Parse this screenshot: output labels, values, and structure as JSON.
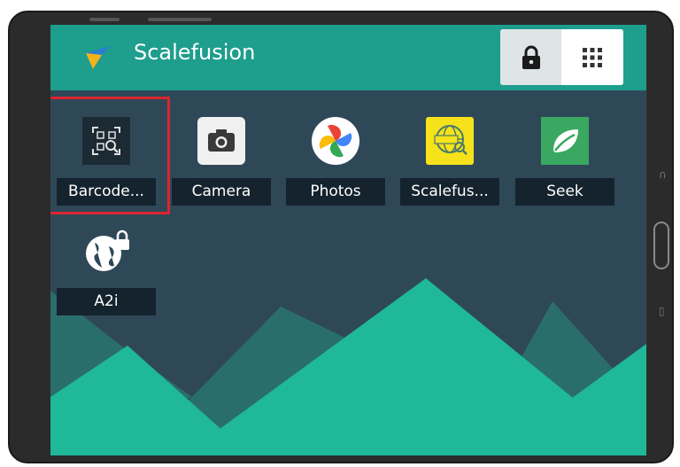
{
  "header": {
    "title": "Scalefusion",
    "logo_icon": "scalefusion-logo-icon",
    "lock_icon": "lock-icon",
    "grid_icon": "app-grid-icon"
  },
  "apps": [
    {
      "label": "Barcode...",
      "icon": "barcode-scanner-icon",
      "highlighted": true
    },
    {
      "label": "Camera",
      "icon": "camera-icon"
    },
    {
      "label": "Photos",
      "icon": "photos-pinwheel-icon"
    },
    {
      "label": "Scalefus...",
      "icon": "scalefusion-browser-icon"
    },
    {
      "label": "Seek",
      "icon": "seek-leaf-icon"
    },
    {
      "label": "A2i",
      "icon": "globe-lock-icon"
    }
  ],
  "colors": {
    "header": "#1e9e8d",
    "background": "#2f4858",
    "mountain_light": "#1fb898",
    "mountain_dark": "#2a6e6c",
    "highlight": "#d9252e"
  }
}
